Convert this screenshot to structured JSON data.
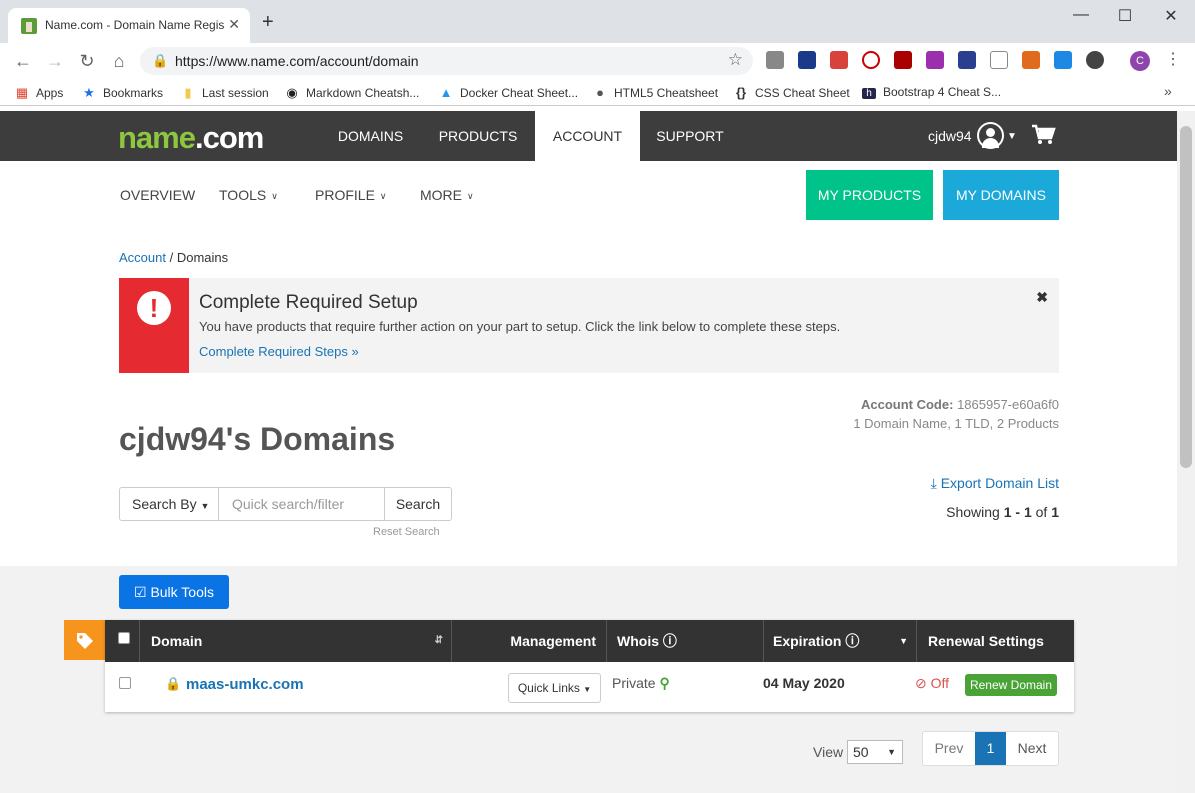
{
  "browser": {
    "tab_title": "Name.com - Domain Name Regis",
    "tab_close": "✕",
    "new_tab": "+",
    "url": "https://www.name.com/account/domain",
    "bookmarks": [
      {
        "label": "Apps",
        "icon": "apps-grid-icon"
      },
      {
        "label": "Bookmarks",
        "icon": "star-icon"
      },
      {
        "label": "Last session",
        "icon": "folder-icon"
      },
      {
        "label": "Markdown Cheatsh...",
        "icon": "github-icon"
      },
      {
        "label": "Docker Cheat Sheet...",
        "icon": "docker-icon"
      },
      {
        "label": "HTML5 Cheatsheet",
        "icon": "globe-icon"
      },
      {
        "label": "CSS Cheat Sheet",
        "icon": "braces-icon"
      },
      {
        "label": "Bootstrap 4 Cheat S...",
        "icon": "hackr-icon"
      }
    ],
    "profile_initial": "C"
  },
  "site": {
    "logo_main": "name",
    "logo_tld": ".com",
    "nav": [
      "DOMAINS",
      "PRODUCTS",
      "ACCOUNT",
      "SUPPORT"
    ],
    "active_nav": "ACCOUNT",
    "username": "cjdw94"
  },
  "subnav": {
    "overview": "OVERVIEW",
    "tools": "TOOLS",
    "profile": "PROFILE",
    "more": "MORE",
    "my_products": "MY PRODUCTS",
    "my_domains": "MY DOMAINS"
  },
  "colors": {
    "brand_green": "#8dc63f",
    "my_products": "#00c389",
    "my_domains": "#1aa9d8",
    "alert_red": "#e52b31",
    "primary_blue": "#0b74e5",
    "renew_green": "#4aa337",
    "tag_orange": "#f7941d"
  },
  "breadcrumb": {
    "root": "Account",
    "separator": " / ",
    "current": "Domains"
  },
  "alert": {
    "title": "Complete Required Setup",
    "text": "You have products that require further action on your part to setup. Click the link below to complete these steps.",
    "link": "Complete Required Steps »"
  },
  "account": {
    "code_label": "Account Code:",
    "code": "1865957-e60a6f0",
    "summary": "1 Domain Name, 1 TLD, 2 Products"
  },
  "page_title": "cjdw94's Domains",
  "search": {
    "by_label": "Search By",
    "placeholder": "Quick search/filter",
    "value": "",
    "button": "Search",
    "reset": "Reset Search"
  },
  "export": "Export Domain List",
  "showing": {
    "prefix": "Showing ",
    "range": "1 - 1",
    "of": " of ",
    "total": "1"
  },
  "bulk_tools": "Bulk Tools",
  "table": {
    "headers": {
      "domain": "Domain",
      "management": "Management",
      "whois": "Whois",
      "expiration": "Expiration",
      "renewal": "Renewal Settings"
    },
    "rows": [
      {
        "domain": "maas-umkc.com",
        "quick_links": "Quick Links",
        "whois": "Private",
        "expiration": "04 May 2020",
        "renewal_status": "Off",
        "renew_button": "Renew Domain"
      }
    ]
  },
  "pagination": {
    "view_label": "View",
    "per_page": "50",
    "prev": "Prev",
    "current": "1",
    "next": "Next"
  }
}
